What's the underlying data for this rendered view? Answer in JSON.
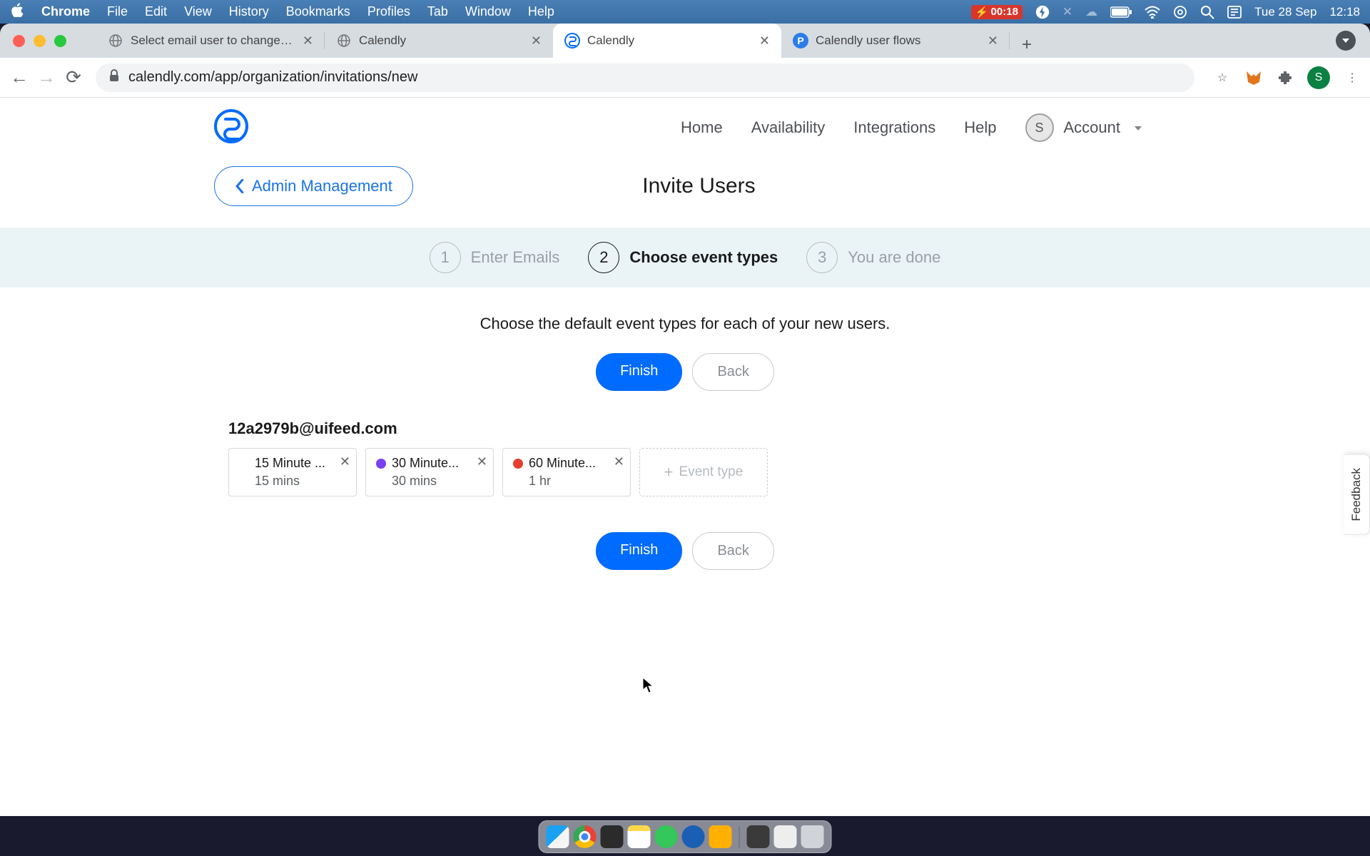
{
  "menubar": {
    "app": "Chrome",
    "items": [
      "File",
      "Edit",
      "View",
      "History",
      "Bookmarks",
      "Profiles",
      "Tab",
      "Window",
      "Help"
    ],
    "battery_text": "00:18",
    "date": "Tue 28 Sep",
    "time": "12:18"
  },
  "tabs": [
    {
      "title": "Select email user to change | D",
      "favicon": "globe"
    },
    {
      "title": "Calendly",
      "favicon": "globe"
    },
    {
      "title": "Calendly",
      "favicon": "calendly",
      "active": true
    },
    {
      "title": "Calendly user flows",
      "favicon": "p-blue"
    }
  ],
  "address_bar": {
    "url": "calendly.com/app/organization/invitations/new"
  },
  "app_nav": {
    "items": [
      "Home",
      "Availability",
      "Integrations",
      "Help"
    ],
    "account_label": "Account",
    "avatar_initial": "S"
  },
  "back_button": "Admin Management",
  "page_title": "Invite Users",
  "stepper": [
    {
      "num": "1",
      "label": "Enter Emails"
    },
    {
      "num": "2",
      "label": "Choose event types",
      "active": true
    },
    {
      "num": "3",
      "label": "You are done"
    }
  ],
  "instruction": "Choose the default event types for each of your new users.",
  "buttons": {
    "finish": "Finish",
    "back": "Back"
  },
  "user_email": "12a2979b@uifeed.com",
  "event_types": [
    {
      "name": "15 Minute ...",
      "duration": "15 mins",
      "color": "#f3c94b"
    },
    {
      "name": "30 Minute...",
      "duration": "30 mins",
      "color": "#7b3ff2"
    },
    {
      "name": "60 Minute...",
      "duration": "1 hr",
      "color": "#e63e2c"
    }
  ],
  "add_event_label": "Event type",
  "feedback_label": "Feedback",
  "profile_avatar": "S"
}
